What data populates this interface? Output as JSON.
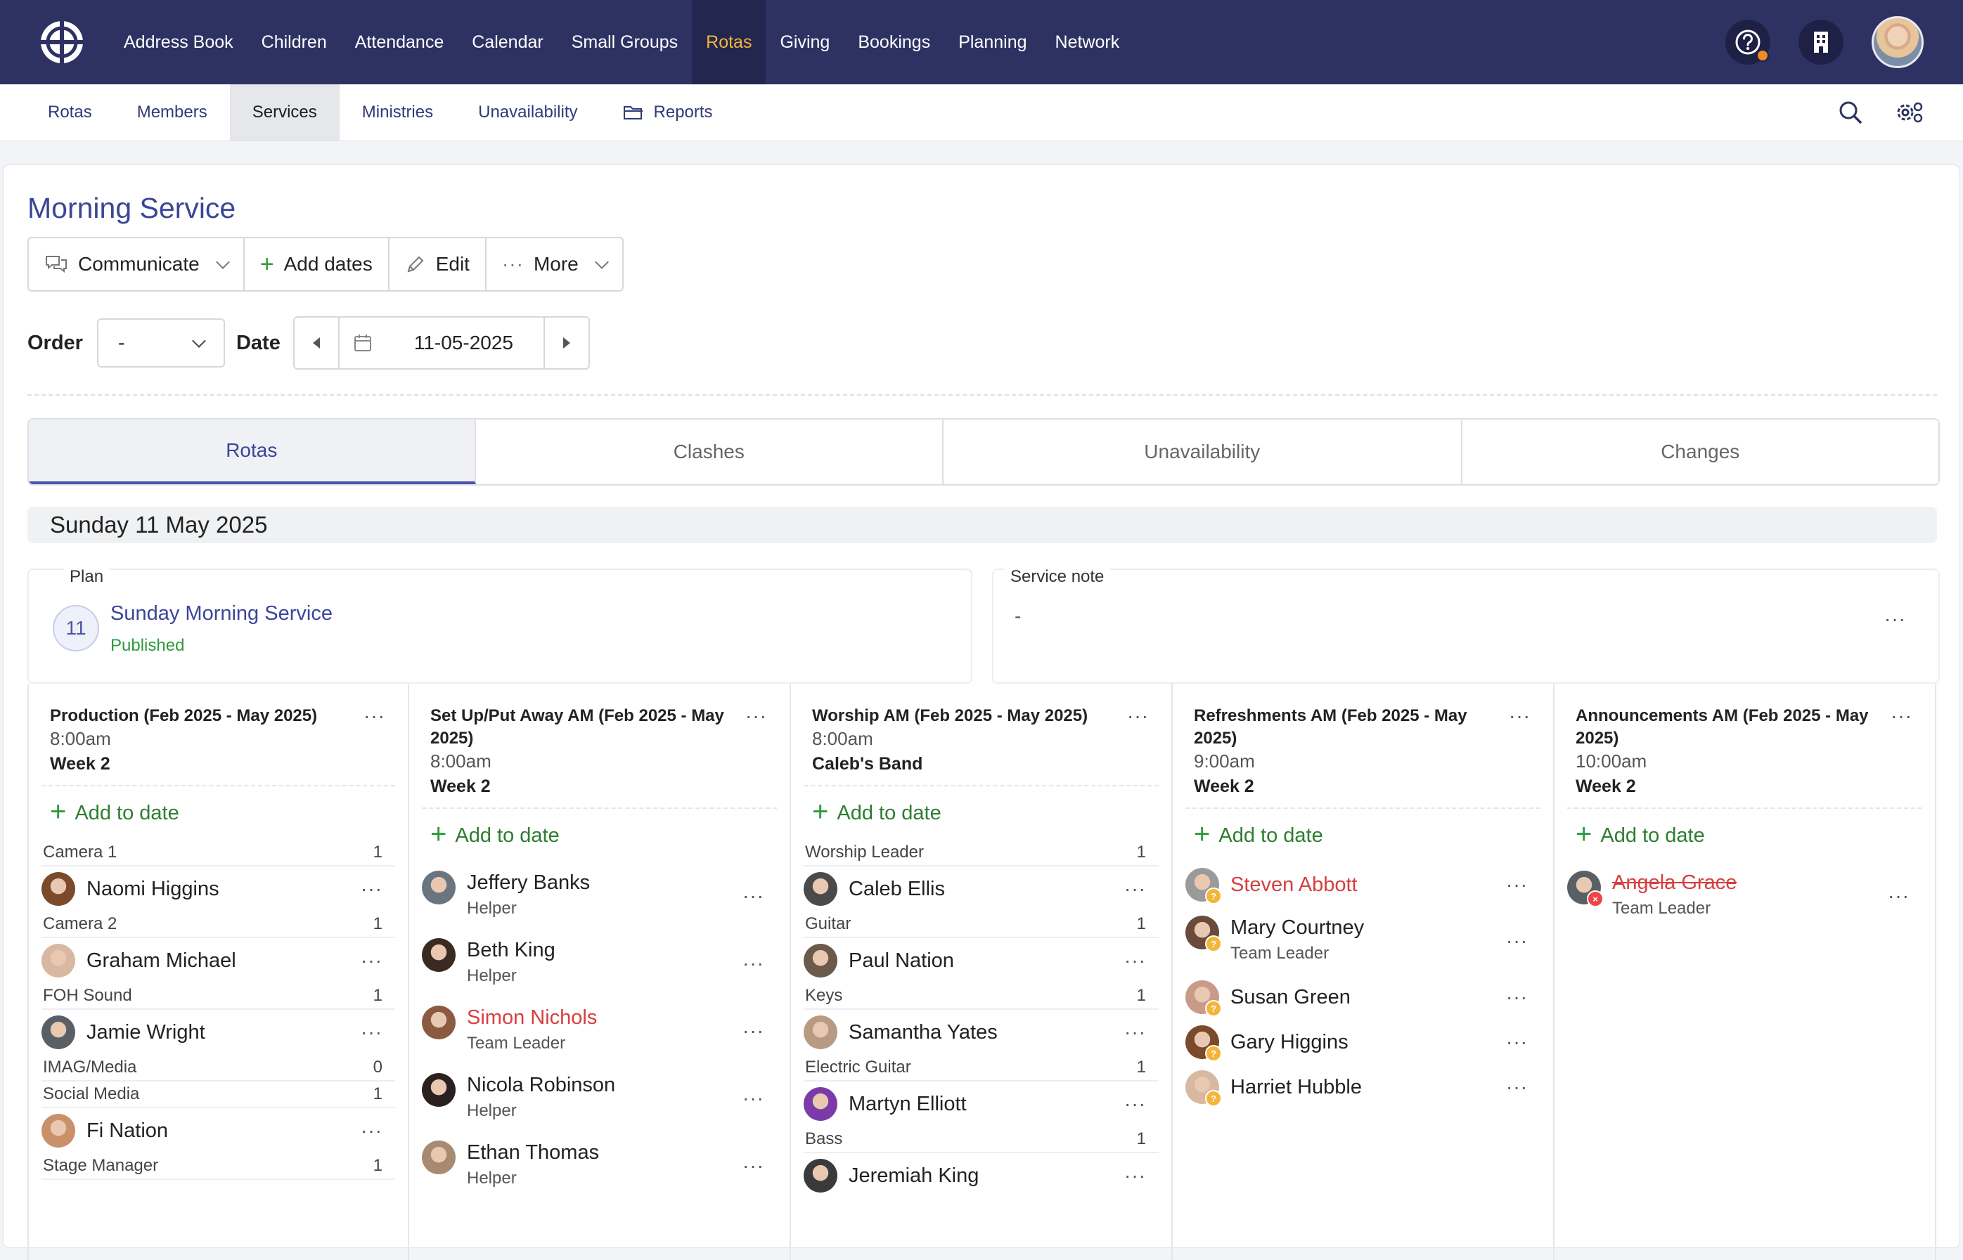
{
  "nav": {
    "items": [
      "Address Book",
      "Children",
      "Attendance",
      "Calendar",
      "Small Groups",
      "Rotas",
      "Giving",
      "Bookings",
      "Planning",
      "Network"
    ],
    "active": "Rotas"
  },
  "subnav": {
    "items": [
      "Rotas",
      "Members",
      "Services",
      "Ministries",
      "Unavailability",
      "Reports"
    ],
    "active": "Services"
  },
  "page": {
    "title": "Morning Service"
  },
  "toolbar": {
    "communicate": "Communicate",
    "add_dates": "Add dates",
    "edit": "Edit",
    "more": "More"
  },
  "filters": {
    "order_label": "Order",
    "order_value": "-",
    "date_label": "Date",
    "date_value": "11-05-2025"
  },
  "tabs": [
    "Rotas",
    "Clashes",
    "Unavailability",
    "Changes"
  ],
  "date_heading": "Sunday 11 May 2025",
  "plan": {
    "label": "Plan",
    "day": "11",
    "title": "Sunday Morning Service",
    "status": "Published"
  },
  "service_note": {
    "label": "Service note",
    "text": "-"
  },
  "add_to_date": "Add to date",
  "columns": [
    {
      "title": "Production (Feb 2025 - May 2025)",
      "time": "8:00am",
      "week": "Week 2",
      "people": [
        {
          "role": "Camera 1",
          "count": "1"
        },
        {
          "name": "Naomi Higgins"
        },
        {
          "role": "Camera 2",
          "count": "1"
        },
        {
          "name": "Graham Michael"
        },
        {
          "role": "FOH Sound",
          "count": "1"
        },
        {
          "name": "Jamie Wright"
        },
        {
          "role": "IMAG/Media",
          "count": "0"
        },
        {
          "role": "Social Media",
          "count": "1"
        },
        {
          "name": "Fi Nation"
        },
        {
          "role": "Stage Manager",
          "count": "1"
        }
      ]
    },
    {
      "title": "Set Up/Put Away AM (Feb 2025 - May 2025)",
      "time": "8:00am",
      "week": "Week 2",
      "people": [
        {
          "name": "Jeffery Banks",
          "sub": "Helper"
        },
        {
          "name": "Beth King",
          "sub": "Helper"
        },
        {
          "name": "Simon Nichols",
          "sub": "Team Leader",
          "state": "red"
        },
        {
          "name": "Nicola Robinson",
          "sub": "Helper"
        },
        {
          "name": "Ethan Thomas",
          "sub": "Helper"
        }
      ]
    },
    {
      "title": "Worship AM (Feb 2025 - May 2025)",
      "time": "8:00am",
      "week": "Caleb's Band",
      "people": [
        {
          "role": "Worship Leader",
          "count": "1"
        },
        {
          "name": "Caleb Ellis"
        },
        {
          "role": "Guitar",
          "count": "1"
        },
        {
          "name": "Paul Nation"
        },
        {
          "role": "Keys",
          "count": "1"
        },
        {
          "name": "Samantha Yates"
        },
        {
          "role": "Electric Guitar",
          "count": "1"
        },
        {
          "name": "Martyn Elliott"
        },
        {
          "role": "Bass",
          "count": "1"
        },
        {
          "name": "Jeremiah King"
        }
      ]
    },
    {
      "title": "Refreshments AM (Feb 2025 - May 2025)",
      "time": "9:00am",
      "week": "Week 2",
      "people": [
        {
          "name": "Steven Abbott",
          "state": "red",
          "badge": "?"
        },
        {
          "name": "Mary Courtney",
          "sub": "Team Leader",
          "badge": "?"
        },
        {
          "name": "Susan Green",
          "badge": "?"
        },
        {
          "name": "Gary Higgins",
          "badge": "?"
        },
        {
          "name": "Harriet Hubble",
          "badge": "?"
        }
      ]
    },
    {
      "title": "Announcements AM (Feb 2025 - May 2025)",
      "time": "10:00am",
      "week": "Week 2",
      "people": [
        {
          "name": "Angela Grace",
          "sub": "Team Leader",
          "state": "red-strike",
          "badge": "x"
        }
      ]
    }
  ],
  "colors": {
    "nav_bg": "#2e3263",
    "accent": "#f3b53a",
    "link": "#3b4598",
    "green": "#2e9a3e",
    "red": "#d63f3f"
  },
  "icons": [
    "logo-icon",
    "help-icon",
    "building-icon",
    "search-icon",
    "gear-icon",
    "folder-icon",
    "chat-icon",
    "plus-icon",
    "pencil-icon",
    "ellipsis-icon",
    "calendar-icon",
    "caret-left-icon",
    "caret-right-icon"
  ]
}
